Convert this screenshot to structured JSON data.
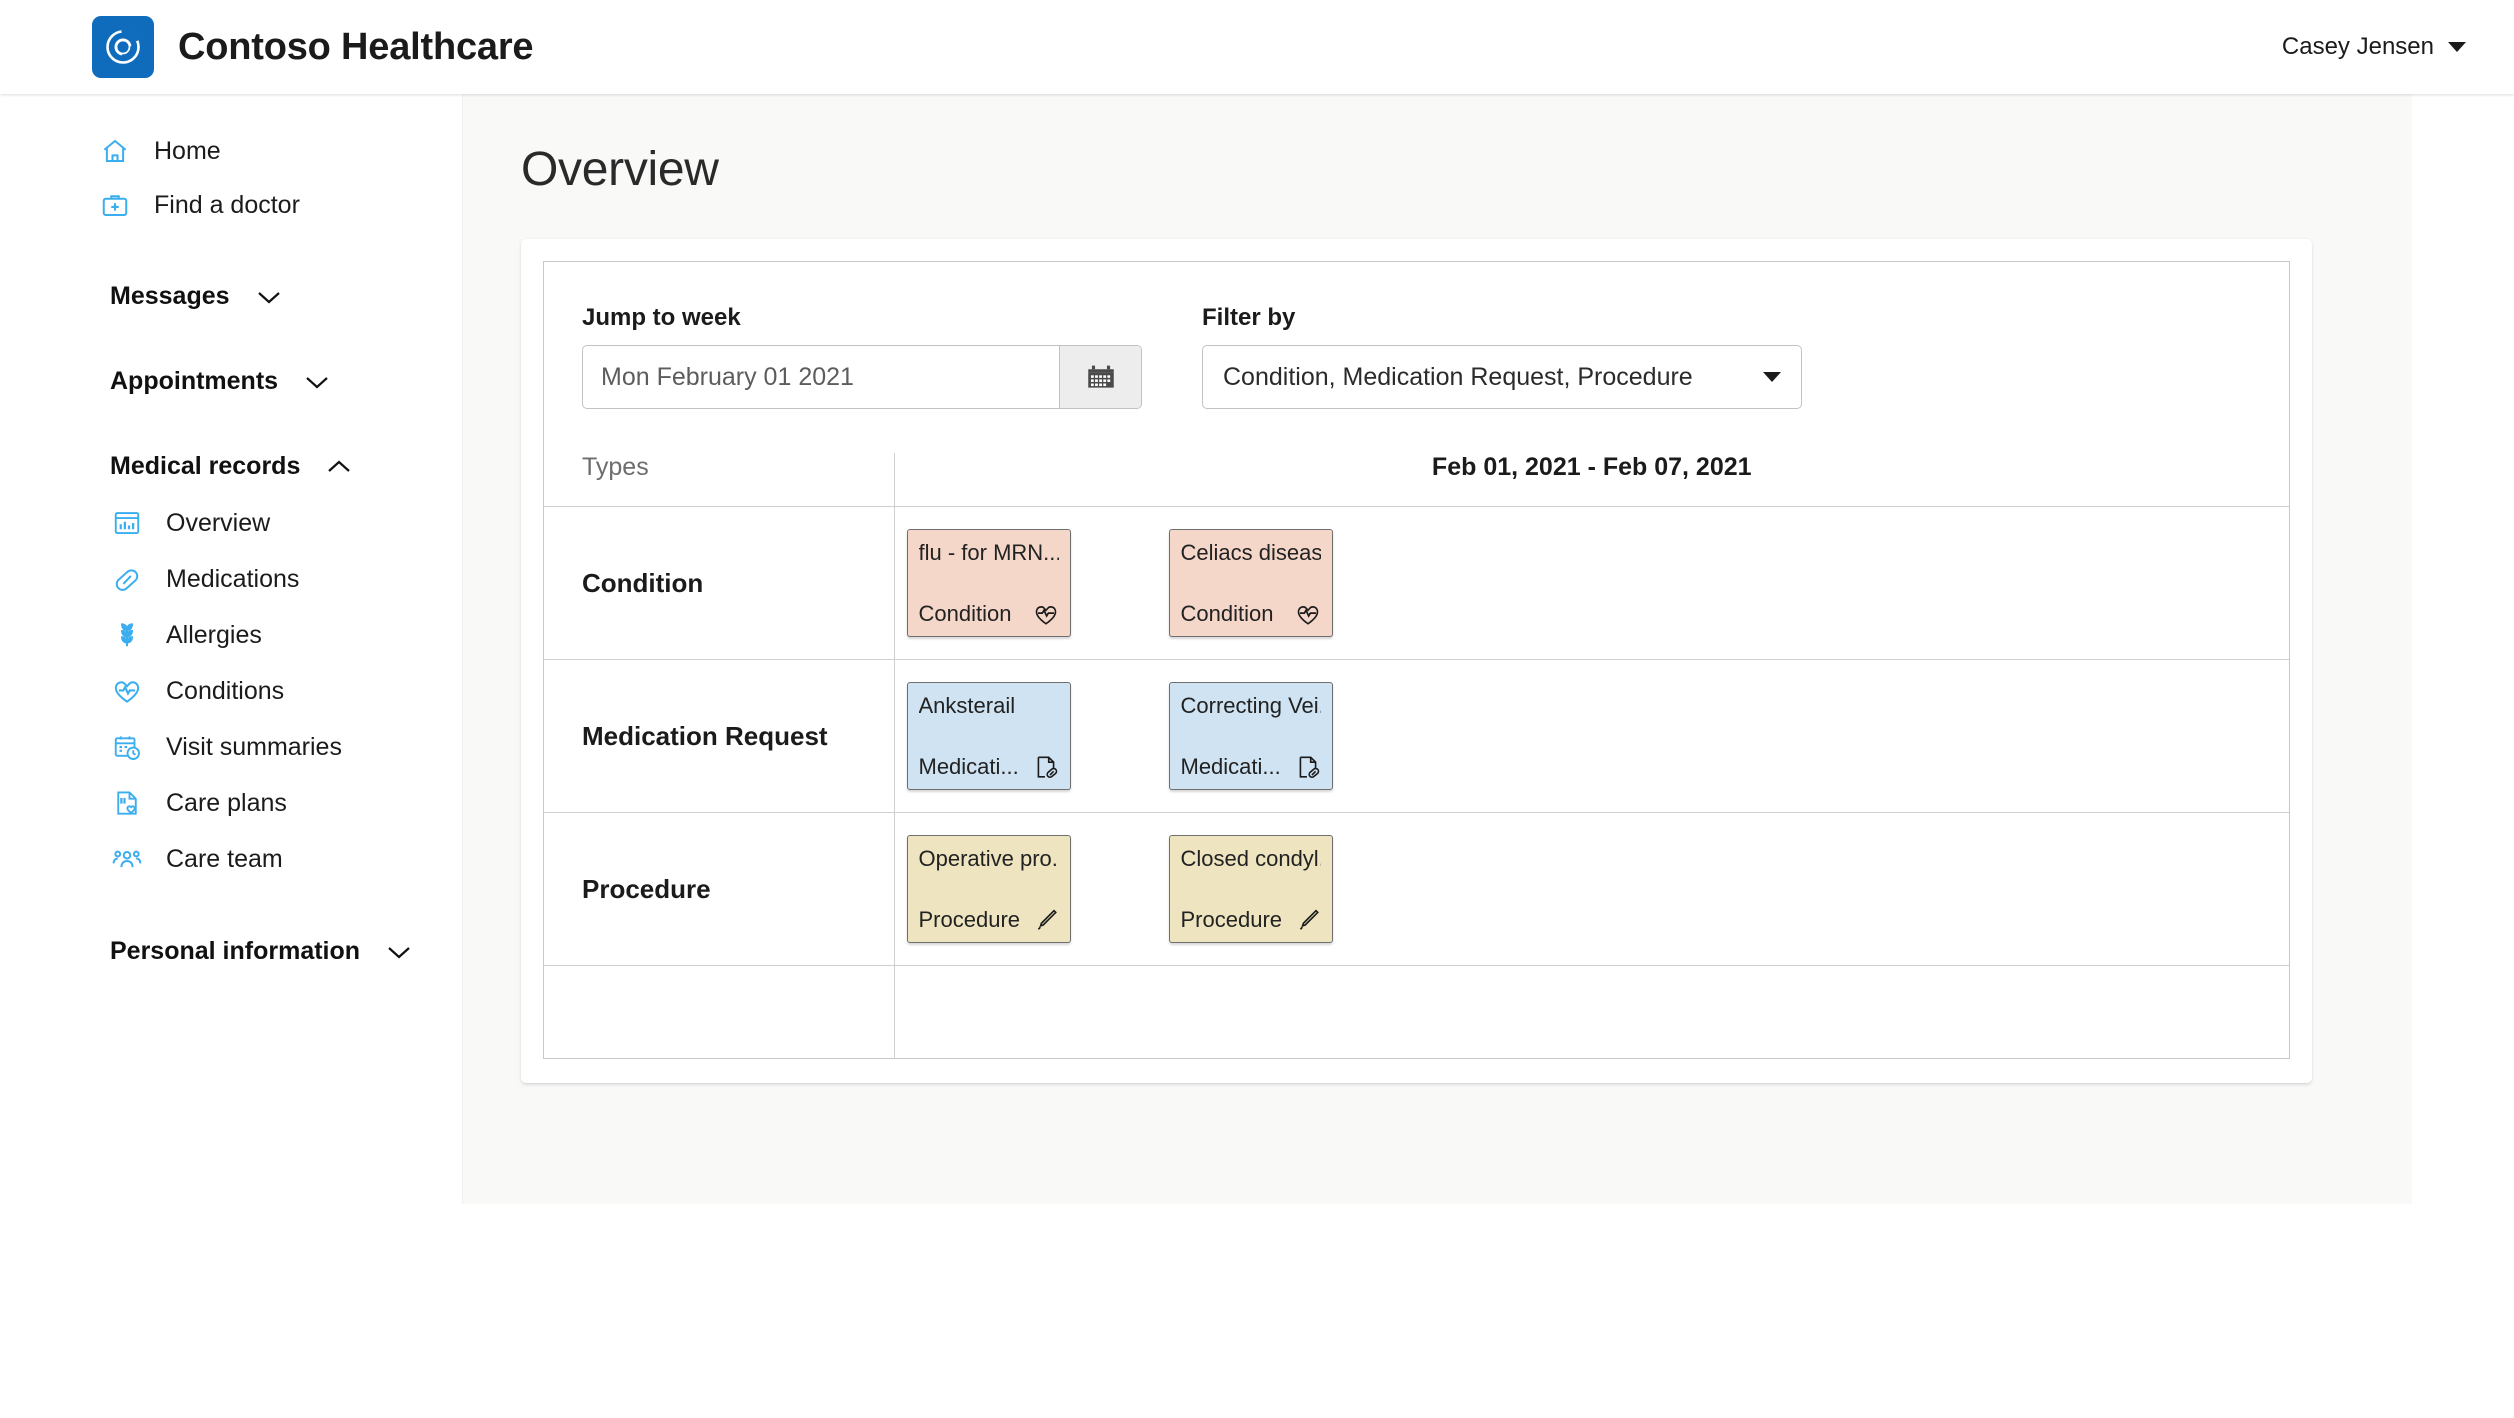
{
  "header": {
    "brand_title": "Contoso Healthcare",
    "logo_icon": "contoso-swirl-logo",
    "user_name": "Casey Jensen",
    "user_caret_icon": "chevron-down-icon"
  },
  "sidebar": {
    "links": [
      {
        "label": "Home",
        "icon": "home-icon"
      },
      {
        "label": "Find a doctor",
        "icon": "doctor-bag-icon"
      }
    ],
    "sections": [
      {
        "label": "Messages",
        "icon": "chevron-down-icon",
        "expanded": false
      },
      {
        "label": "Appointments",
        "icon": "chevron-down-icon",
        "expanded": false
      },
      {
        "label": "Medical records",
        "icon": "chevron-up-icon",
        "expanded": true
      },
      {
        "label": "Personal information",
        "icon": "chevron-down-icon",
        "expanded": false
      }
    ],
    "medical_records_items": [
      {
        "label": "Overview",
        "icon": "chart-report-icon"
      },
      {
        "label": "Medications",
        "icon": "pill-capsule-icon"
      },
      {
        "label": "Allergies",
        "icon": "wheat-allergy-icon"
      },
      {
        "label": "Conditions",
        "icon": "heart-pulse-icon"
      },
      {
        "label": "Visit summaries",
        "icon": "calendar-clock-icon"
      },
      {
        "label": "Care plans",
        "icon": "document-heart-icon"
      },
      {
        "label": "Care team",
        "icon": "people-team-icon"
      }
    ]
  },
  "main": {
    "page_title": "Overview",
    "jump_to_week": {
      "label": "Jump to week",
      "value": "Mon February 01 2021",
      "placeholder": "Mon February 01 2021",
      "calendar_icon": "calendar-icon"
    },
    "filter_by": {
      "label": "Filter by",
      "value": "Condition, Medication Request, Procedure",
      "caret_icon": "chevron-down-icon"
    },
    "timeline": {
      "types_header": "Types",
      "date_range": "Feb 01, 2021 - Feb 07, 2021",
      "rows": [
        {
          "type": "Condition",
          "color": "#f5d7c9",
          "events": [
            {
              "title": "flu - for MRN...",
              "category": "Condition",
              "icon": "heart-pulse-icon"
            },
            {
              "title": "Celiacs diseas...",
              "category": "Condition",
              "icon": "heart-pulse-icon"
            }
          ]
        },
        {
          "type": "Medication Request",
          "color": "#cfe3f2",
          "events": [
            {
              "title": "Anksterail",
              "category": "Medicati...",
              "icon": "document-pill-icon"
            },
            {
              "title": "Correcting Vei...",
              "category": "Medicati...",
              "icon": "document-pill-icon"
            }
          ]
        },
        {
          "type": "Procedure",
          "color": "#eee5c0",
          "events": [
            {
              "title": "Operative pro...",
              "category": "Procedure",
              "icon": "scalpel-icon"
            },
            {
              "title": "Closed condyl...",
              "category": "Procedure",
              "icon": "scalpel-icon"
            }
          ]
        }
      ]
    }
  },
  "colors": {
    "brand_blue": "#0f6cbd",
    "icon_blue": "#3aaeef",
    "condition": "#f5d7c9",
    "medication": "#cfe3f2",
    "procedure": "#eee5c0",
    "content_bg": "#f9f9f8"
  }
}
